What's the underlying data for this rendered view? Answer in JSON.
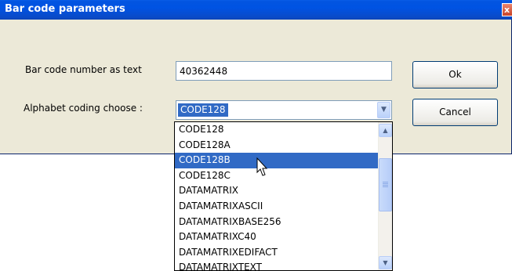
{
  "window": {
    "title": "Bar code parameters",
    "close_label": "x"
  },
  "form": {
    "number_label": "Bar code number as text",
    "number_value": "40362448",
    "alphabet_label": "Alphabet coding choose :",
    "alphabet_selected": "CODE128"
  },
  "buttons": {
    "ok": "Ok",
    "cancel": "Cancel"
  },
  "dropdown": {
    "items": [
      "CODE128",
      "CODE128A",
      "CODE128B",
      "CODE128C",
      "DATAMATRIX",
      "DATAMATRIXASCII",
      "DATAMATRIXBASE256",
      "DATAMATRIXC40",
      "DATAMATRIXEDIFACT",
      "DATAMATRIXTEXT"
    ],
    "highlighted": "CODE128B"
  },
  "colors": {
    "titlebar": "#0053e3",
    "selection": "#316ac5",
    "dialog_bg": "#ece9d8"
  },
  "icons": {
    "dropdown_arrow": "chevron-down-icon",
    "scroll_up": "chevron-up-icon",
    "scroll_down": "chevron-down-icon",
    "close": "close-icon",
    "cursor": "mouse-pointer-icon"
  }
}
